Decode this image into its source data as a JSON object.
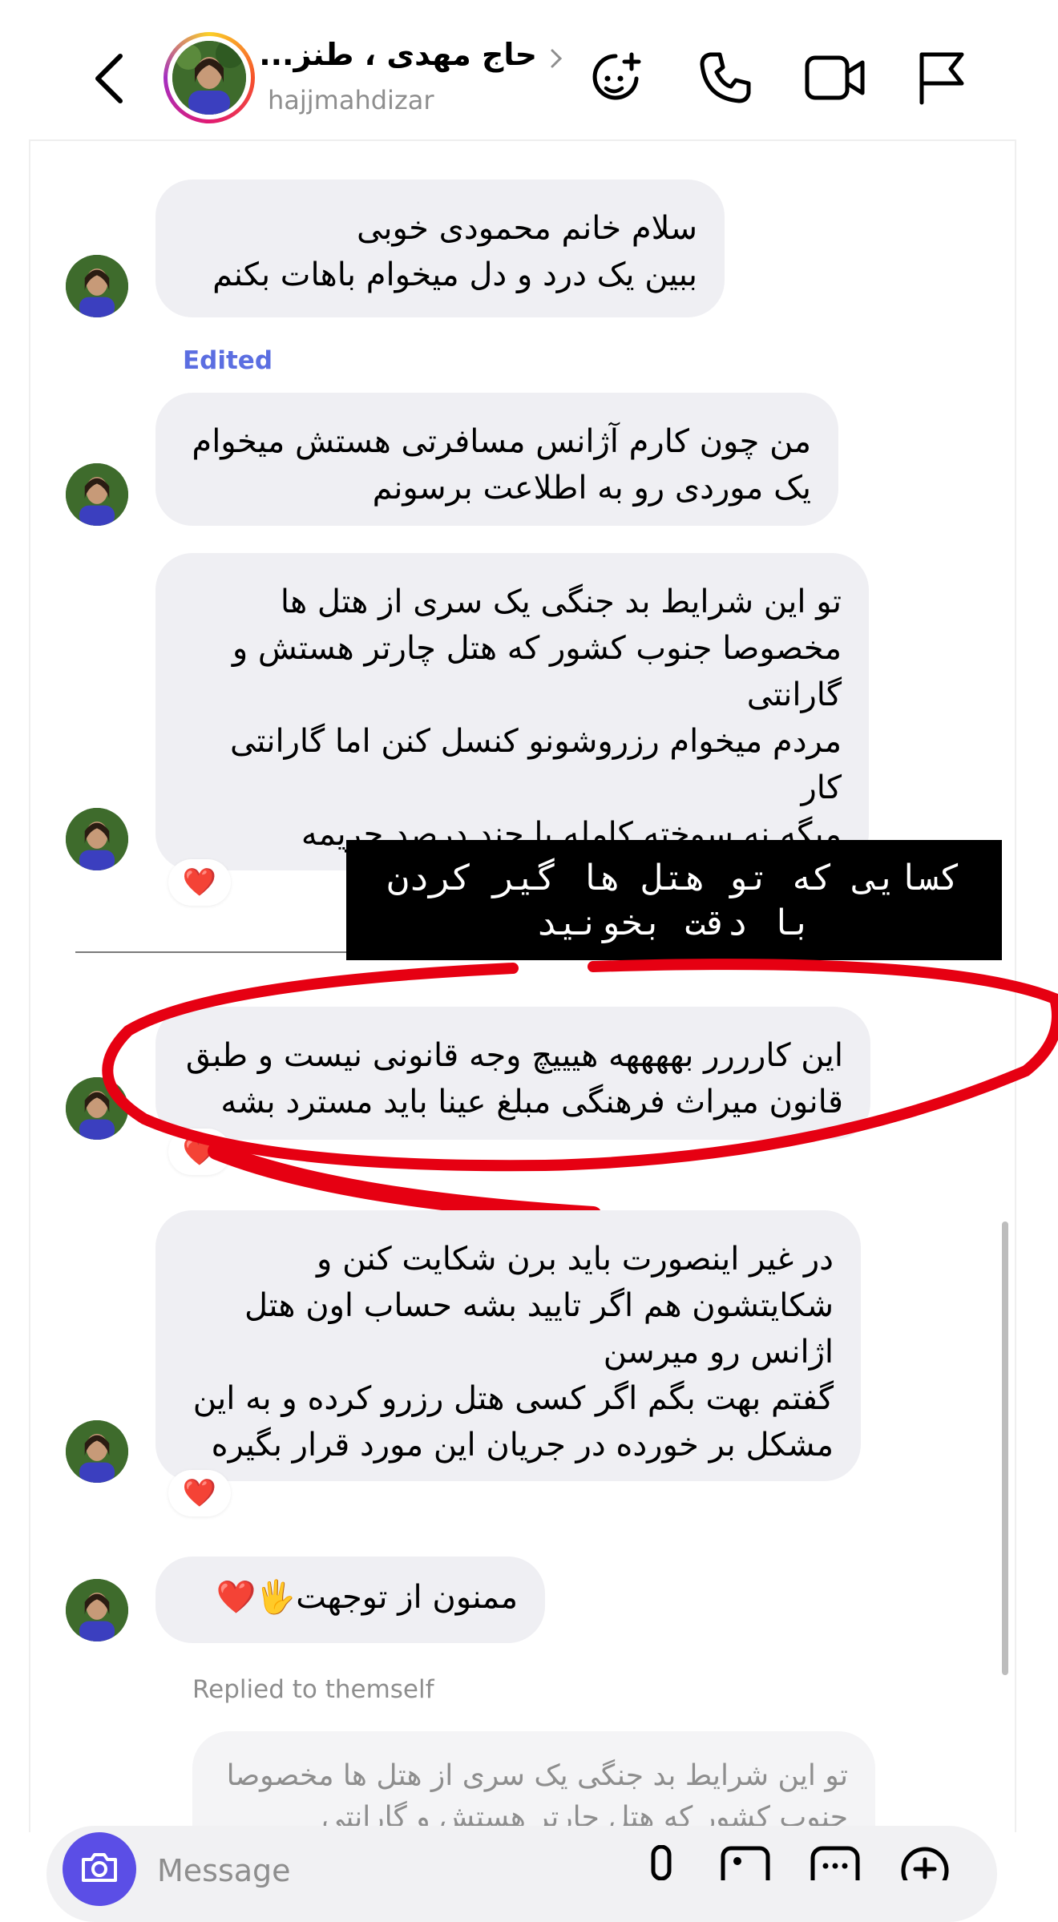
{
  "header": {
    "name": "حاج مهدی ، طنز...",
    "username": "hajjmahdizar",
    "icons": [
      "back-chevron-icon",
      "chevron-right-icon",
      "effects-icon",
      "phone-icon",
      "video-icon",
      "flag-icon"
    ]
  },
  "messages": [
    {
      "text": "سلام خانم محمودی خوبی\nببین یک درد و دل میخوام باهات بکنم"
    },
    {
      "label": "Edited",
      "text": "من چون کارم آژانس مسافرتی هستش میخوام\nیک موردی رو به اطلاعت برسونم"
    },
    {
      "text": "تو این شرایط بد جنگی یک سری از هتل ها\nمخصوصا جنوب کشور که هتل چارتر هستش و\nگارانتی\nمردم میخوام رزروشونو کنسل کنن اما گارانتی کار\nمیگه نه سوخته کامله یا چند درصد جریمه\nمیگیرن",
      "reaction": "❤️"
    },
    {
      "text": "این کارررر بههههه هیییچ وجه قانونی نیست و طبق\nقانون میراث فرهنگی مبلغ عینا باید مسترد بشه",
      "reaction": "❤️"
    },
    {
      "text": "در غیر اینصورت باید برن شکایت کنن و\nشکایتشون هم اگر تایید بشه حساب اون هتل\nاژانس رو میرسن\nگفتم بهت بگم اگر کسی هتل رزرو کرده و به این\nمشکل بر خورده در جریان این مورد قرار بگیره",
      "reaction": "❤️"
    },
    {
      "text": "ممنون از توجهت🖐️❤️"
    }
  ],
  "overlay_caption": "کسایی که تو هتل ها گیر کردن\nبا دقت بخونید",
  "replied_label": "Replied to themself",
  "reply_preview": "تو این شرایط بد جنگی یک سری از هتل ها مخصوصا\nجنوب کشور که هتل چارتر هستش و گارانتی",
  "composer": {
    "placeholder": "Message",
    "icons": [
      "camera-icon",
      "microphone-icon",
      "gallery-icon",
      "sticker-icon",
      "plus-icon"
    ]
  },
  "colors": {
    "bubble": "#efeff3",
    "accent": "#5b4ee6",
    "edited": "#5b6ee1",
    "annotation": "#e60012"
  }
}
